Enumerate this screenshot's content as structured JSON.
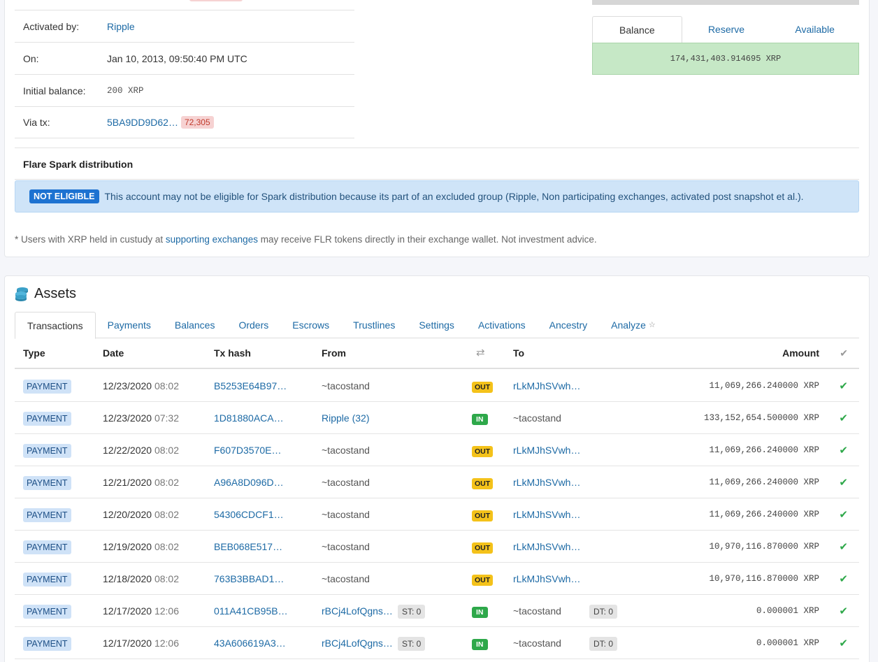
{
  "account_info": {
    "activated_by_label": "Activated by:",
    "activated_by_value": "Ripple",
    "on_label": "On:",
    "on_value": "Jan 10, 2013, 09:50:40 PM UTC",
    "initial_balance_label": "Initial balance:",
    "initial_balance_value": "200 XRP",
    "via_tx_label": "Via tx:",
    "via_tx_value": "5BA9DD9D62…",
    "via_tx_badge": "72,305"
  },
  "balance_box": {
    "tabs": [
      "Balance",
      "Reserve",
      "Available"
    ],
    "active_tab": "Balance",
    "value": "174,431,403.914695 XRP"
  },
  "flare": {
    "title": "Flare Spark distribution",
    "badge": "NOT ELIGIBLE",
    "message": "This account may not be eligible for Spark distribution because its part of an excluded group (Ripple, Non participating exchanges, activated post snapshot et al.).",
    "footnote_prefix": "* Users with XRP held in custudy at ",
    "footnote_link": "supporting exchanges",
    "footnote_suffix": " may receive FLR tokens directly in their exchange wallet. Not investment advice."
  },
  "assets": {
    "title": "Assets",
    "tabs": [
      "Transactions",
      "Payments",
      "Balances",
      "Orders",
      "Escrows",
      "Trustlines",
      "Settings",
      "Activations",
      "Ancestry",
      "Analyze"
    ],
    "analyze_star": "☆",
    "columns": {
      "type": "Type",
      "date": "Date",
      "tx_hash": "Tx hash",
      "from": "From",
      "direction_icon": "⇄",
      "to": "To",
      "amount": "Amount",
      "status_icon": "✔"
    },
    "rows": [
      {
        "type": "PAYMENT",
        "date": "12/23/2020",
        "time": "08:02",
        "hash": "B5253E64B97…",
        "from": "~tacostand",
        "from_link": false,
        "from_badge": "",
        "dir": "OUT",
        "to": "rLkMJhSVwh…",
        "to_link": true,
        "to_badge": "",
        "amount": "11,069,266.240000 XRP"
      },
      {
        "type": "PAYMENT",
        "date": "12/23/2020",
        "time": "07:32",
        "hash": "1D81880ACA…",
        "from": "Ripple (32)",
        "from_link": true,
        "from_badge": "",
        "dir": "IN",
        "to": "~tacostand",
        "to_link": false,
        "to_badge": "",
        "amount": "133,152,654.500000 XRP"
      },
      {
        "type": "PAYMENT",
        "date": "12/22/2020",
        "time": "08:02",
        "hash": "F607D3570E…",
        "from": "~tacostand",
        "from_link": false,
        "from_badge": "",
        "dir": "OUT",
        "to": "rLkMJhSVwh…",
        "to_link": true,
        "to_badge": "",
        "amount": "11,069,266.240000 XRP"
      },
      {
        "type": "PAYMENT",
        "date": "12/21/2020",
        "time": "08:02",
        "hash": "A96A8D096D…",
        "from": "~tacostand",
        "from_link": false,
        "from_badge": "",
        "dir": "OUT",
        "to": "rLkMJhSVwh…",
        "to_link": true,
        "to_badge": "",
        "amount": "11,069,266.240000 XRP"
      },
      {
        "type": "PAYMENT",
        "date": "12/20/2020",
        "time": "08:02",
        "hash": "54306CDCF1…",
        "from": "~tacostand",
        "from_link": false,
        "from_badge": "",
        "dir": "OUT",
        "to": "rLkMJhSVwh…",
        "to_link": true,
        "to_badge": "",
        "amount": "11,069,266.240000 XRP"
      },
      {
        "type": "PAYMENT",
        "date": "12/19/2020",
        "time": "08:02",
        "hash": "BEB068E517…",
        "from": "~tacostand",
        "from_link": false,
        "from_badge": "",
        "dir": "OUT",
        "to": "rLkMJhSVwh…",
        "to_link": true,
        "to_badge": "",
        "amount": "10,970,116.870000 XRP"
      },
      {
        "type": "PAYMENT",
        "date": "12/18/2020",
        "time": "08:02",
        "hash": "763B3BBAD1…",
        "from": "~tacostand",
        "from_link": false,
        "from_badge": "",
        "dir": "OUT",
        "to": "rLkMJhSVwh…",
        "to_link": true,
        "to_badge": "",
        "amount": "10,970,116.870000 XRP"
      },
      {
        "type": "PAYMENT",
        "date": "12/17/2020",
        "time": "12:06",
        "hash": "011A41CB95B…",
        "from": "rBCj4LofQgns…",
        "from_link": true,
        "from_badge": "ST: 0",
        "dir": "IN",
        "to": "~tacostand",
        "to_link": false,
        "to_badge": "DT: 0",
        "amount": "0.000001 XRP"
      },
      {
        "type": "PAYMENT",
        "date": "12/17/2020",
        "time": "12:06",
        "hash": "43A606619A3…",
        "from": "rBCj4LofQgns…",
        "from_link": true,
        "from_badge": "ST: 0",
        "dir": "IN",
        "to": "~tacostand",
        "to_link": false,
        "to_badge": "DT: 0",
        "amount": "0.000001 XRP"
      }
    ]
  },
  "colors": {
    "link": "#1d6aa5",
    "out_badge": "#f4c21a",
    "in_badge": "#2ea84a",
    "balance_bg": "#c6e8c6",
    "alert_bg": "#cfe4f8",
    "not_eligible_badge": "#1d72d1"
  }
}
